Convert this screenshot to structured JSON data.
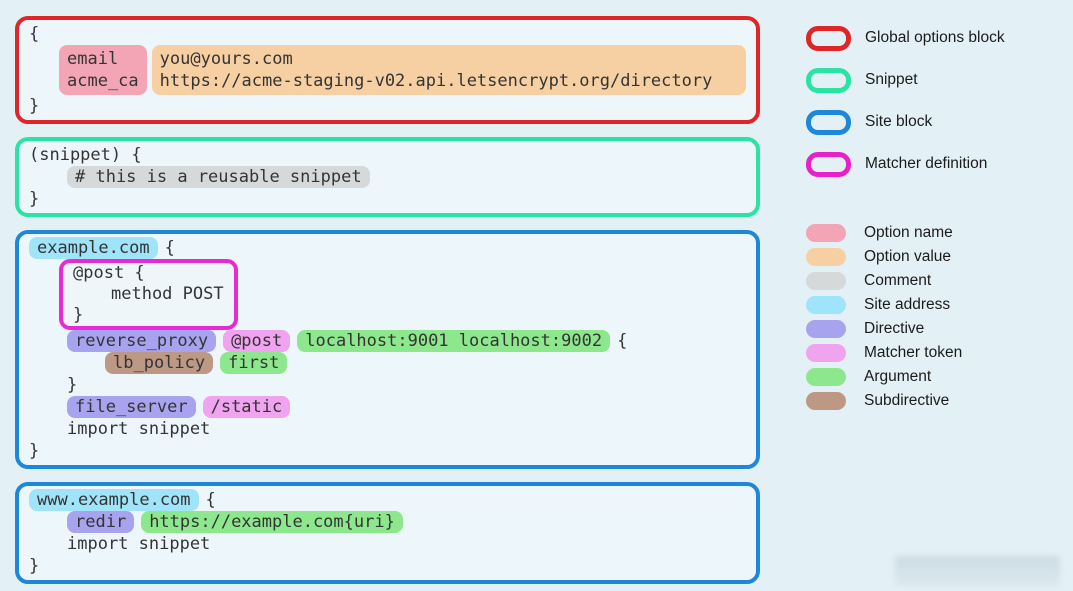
{
  "colors": {
    "page_background": "#e3f1f7",
    "block_background": "#edf6fa",
    "global_options_border": "#e02529",
    "snippet_border": "#2be3a4",
    "site_block_border": "#1d87da",
    "matcher_border": "#e928d6",
    "option_name": "#f4a5b5",
    "option_value": "#f6d0a2",
    "comment": "#d6d9da",
    "site_address": "#9fe4f8",
    "directive": "#a8a3ee",
    "matcher_token": "#f0a3ee",
    "argument": "#8de88d",
    "subdirective": "#bd9885"
  },
  "code": {
    "global": {
      "open_brace": "{",
      "option_names": [
        "email",
        "acme_ca"
      ],
      "option_values": [
        "you@yours.com",
        "https://acme-staging-v02.api.letsencrypt.org/directory"
      ],
      "close_brace": "}"
    },
    "snippet": {
      "header": "(snippet) {",
      "comment": "# this is a reusable snippet",
      "close_brace": "}"
    },
    "site1": {
      "address": "example.com",
      "open_brace": "{",
      "matcher": {
        "header": "@post {",
        "body": "method POST",
        "close_brace": "}"
      },
      "reverse_proxy": {
        "directive": "reverse_proxy",
        "matcher_token": "@post",
        "arguments": "localhost:9001 localhost:9002",
        "open_brace": "{"
      },
      "lb_policy": {
        "subdirective": "lb_policy",
        "argument": "first"
      },
      "nested_close_brace": "}",
      "file_server": {
        "directive": "file_server",
        "matcher_token": "/static"
      },
      "import_line": "import snippet",
      "close_brace": "}"
    },
    "site2": {
      "address": "www.example.com",
      "open_brace": "{",
      "redir": {
        "directive": "redir",
        "argument": "https://example.com{uri}"
      },
      "import_line": "import snippet",
      "close_brace": "}"
    }
  },
  "legend": {
    "block_types": [
      {
        "label": "Global options block"
      },
      {
        "label": "Snippet"
      },
      {
        "label": "Site block"
      },
      {
        "label": "Matcher definition"
      }
    ],
    "token_types": [
      {
        "label": "Option name"
      },
      {
        "label": "Option value"
      },
      {
        "label": "Comment"
      },
      {
        "label": "Site address"
      },
      {
        "label": "Directive"
      },
      {
        "label": "Matcher token"
      },
      {
        "label": "Argument"
      },
      {
        "label": "Subdirective"
      }
    ]
  }
}
